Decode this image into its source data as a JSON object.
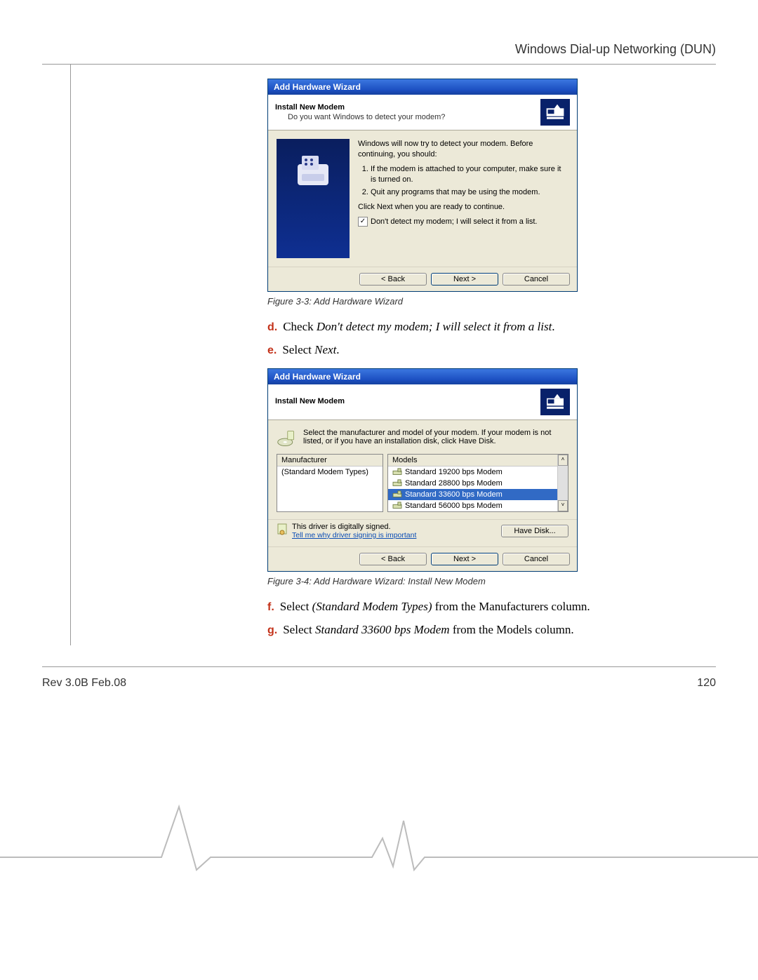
{
  "page": {
    "header": "Windows Dial-up Networking (DUN)",
    "footer_left": "Rev 3.0B Feb.08",
    "footer_right": "120"
  },
  "figure1": {
    "window_title": "Add Hardware Wizard",
    "header_title": "Install New Modem",
    "header_sub": "Do you want Windows to detect your modem?",
    "intro": "Windows will now try to detect your modem.  Before continuing, you should:",
    "li1": "If the modem is attached to your computer, make sure it is turned on.",
    "li2": "Quit any programs that may be using the modem.",
    "cont": "Click Next when you are ready to continue.",
    "checkbox_label": "Don't detect my modem; I will select it from a list.",
    "btn_back": "< Back",
    "btn_next": "Next >",
    "btn_cancel": "Cancel",
    "caption": "Figure 3-3: Add Hardware Wizard"
  },
  "steps1": {
    "d": {
      "marker": "d.",
      "pre": "Check ",
      "em": "Don't detect my modem; I will select it from a list",
      "post": "."
    },
    "e": {
      "marker": "e.",
      "pre": "Select ",
      "em": "Next",
      "post": "."
    }
  },
  "figure2": {
    "window_title": "Add Hardware Wizard",
    "header_title": "Install New Modem",
    "instr": "Select the manufacturer and model of your modem. If your modem is not listed, or if you have an installation disk, click Have Disk.",
    "col_manu": "Manufacturer",
    "col_models": "Models",
    "manu_item": "(Standard Modem Types)",
    "model1": "Standard 19200 bps Modem",
    "model2": "Standard 28800 bps Modem",
    "model3": "Standard 33600 bps Modem",
    "model4": "Standard 56000 bps Modem",
    "signed": "This driver is digitally signed.",
    "signed_link": "Tell me why driver signing is important",
    "havedisk": "Have Disk...",
    "btn_back": "< Back",
    "btn_next": "Next >",
    "btn_cancel": "Cancel",
    "caption": "Figure 3-4: Add Hardware Wizard: Install New Modem"
  },
  "steps2": {
    "f": {
      "marker": "f.",
      "pre": "Select ",
      "em": "(Standard Modem Types)",
      "post": " from the Manufacturers column."
    },
    "g": {
      "marker": "g.",
      "pre": "Select ",
      "em": "Standard 33600 bps Modem",
      "post": " from the Models column."
    }
  }
}
